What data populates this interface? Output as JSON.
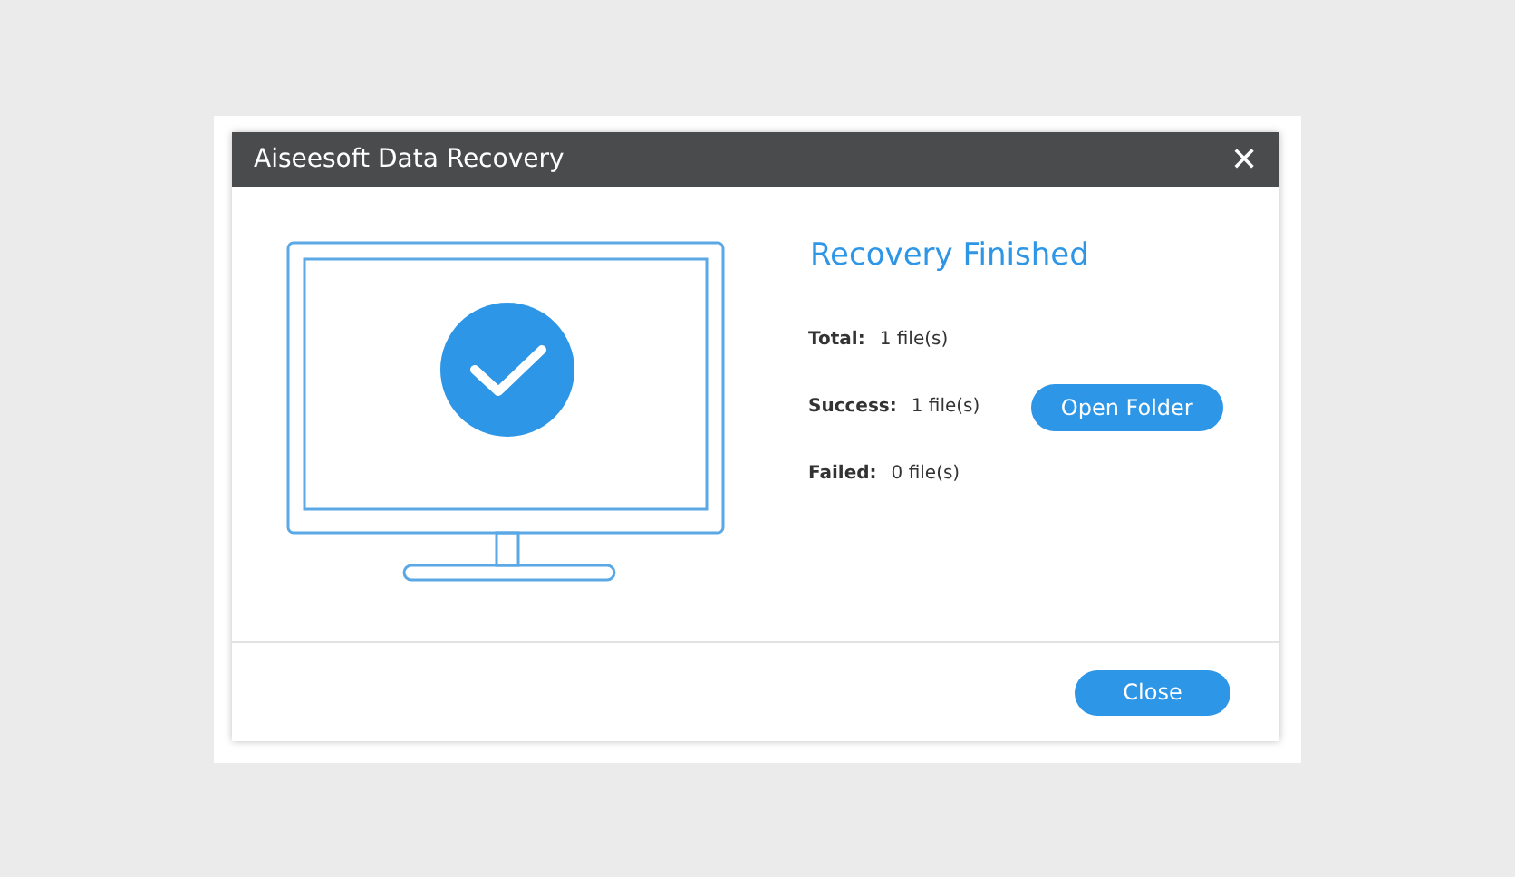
{
  "window": {
    "title": "Aiseesoft Data Recovery",
    "close": "✕"
  },
  "heading": "Recovery Finished",
  "stats": [
    {
      "label": "Total:",
      "value": "1 file(s)"
    },
    {
      "label": "Success:",
      "value": "1 file(s)",
      "button": "Open Folder"
    },
    {
      "label": "Failed:",
      "value": "0 file(s)"
    }
  ],
  "footer_button": "Close"
}
